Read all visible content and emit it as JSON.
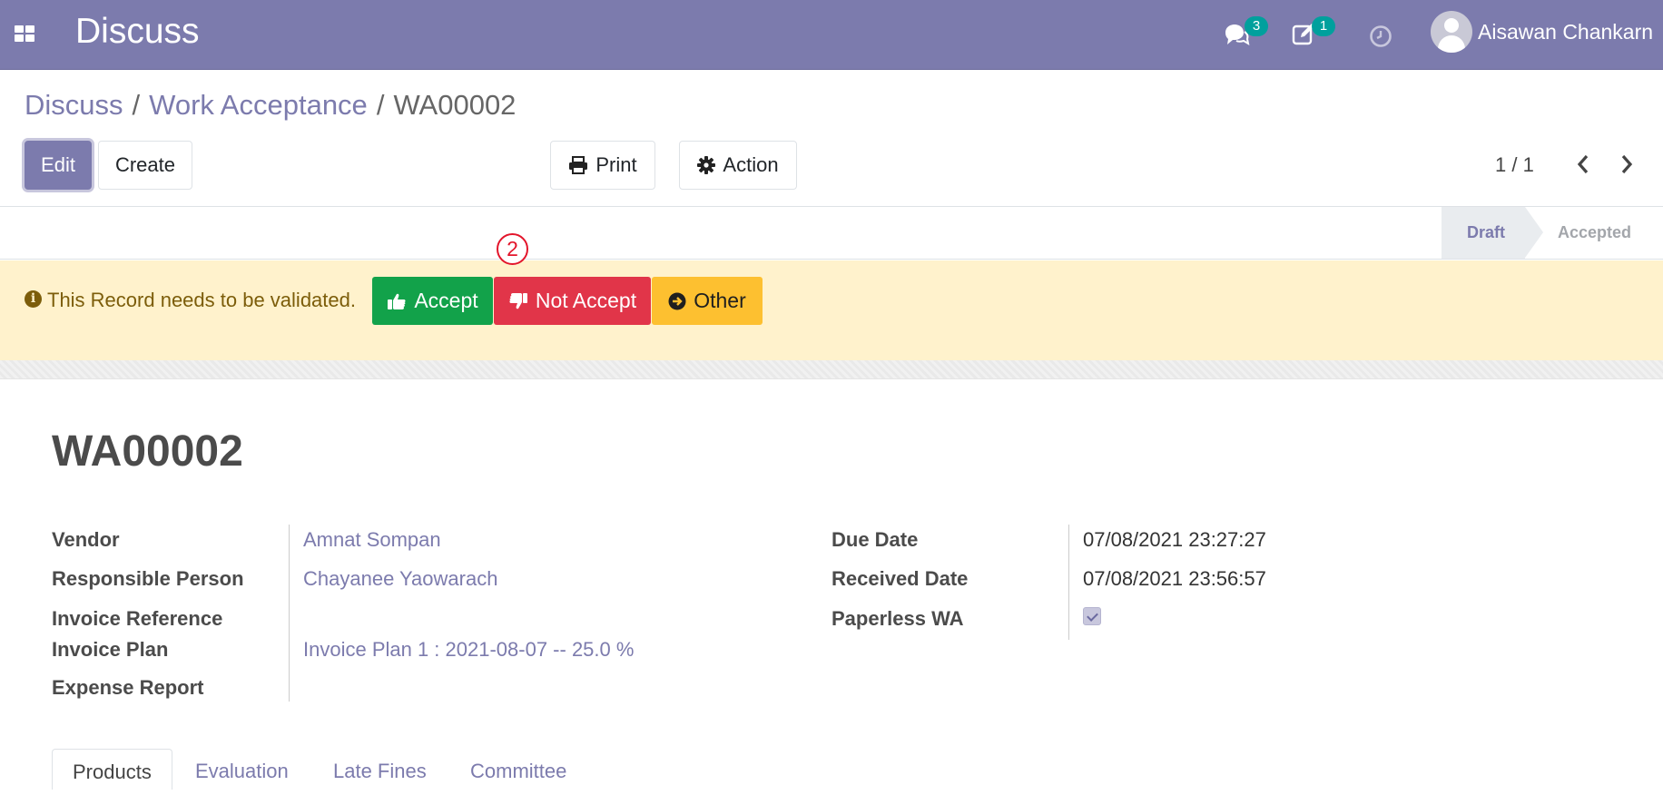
{
  "navbar": {
    "app_title": "Discuss",
    "messages_badge": "3",
    "activities_badge": "1",
    "user_name": "Aisawan Chankarn",
    "background": "#7c7bad"
  },
  "breadcrumb": {
    "items": [
      "Discuss",
      "Work Acceptance",
      "WA00002"
    ],
    "separator": "/"
  },
  "toolbar": {
    "edit_label": "Edit",
    "create_label": "Create",
    "print_label": "Print",
    "action_label": "Action",
    "pager": "1 / 1"
  },
  "statusbar": {
    "stages": [
      "Draft",
      "Accepted"
    ],
    "current": "Draft"
  },
  "alert": {
    "message": "This Record needs to be validated.",
    "accept_label": "Accept",
    "not_accept_label": "Not Accept",
    "other_label": "Other",
    "annotation_number": "2",
    "colors": {
      "accept": "#12a24a",
      "not_accept": "#e13549",
      "other": "#fdc030",
      "background": "#fff2cc"
    }
  },
  "record": {
    "title": "WA00002",
    "left_fields": [
      {
        "label": "Vendor",
        "value": "Amnat Sompan"
      },
      {
        "label": "Responsible Person",
        "value": "Chayanee Yaowarach"
      },
      {
        "label": "Invoice Reference",
        "value": ""
      },
      {
        "label": "Invoice Plan",
        "value": "Invoice Plan 1 : 2021-08-07 -- 25.0 %"
      },
      {
        "label": "Expense Report",
        "value": ""
      }
    ],
    "right_fields": [
      {
        "label": "Due Date",
        "value": "07/08/2021 23:27:27"
      },
      {
        "label": "Received Date",
        "value": "07/08/2021 23:56:57"
      },
      {
        "label": "Paperless WA",
        "value": "checked"
      }
    ]
  },
  "tabs": [
    "Products",
    "Evaluation",
    "Late Fines",
    "Committee"
  ],
  "icons": {
    "apps": "apps-grid-icon",
    "messages": "chat-bubbles-icon",
    "activities": "edit-square-icon",
    "clock": "clock-icon",
    "print": "printer-icon",
    "action": "gear-icon",
    "info": "info-circle-icon",
    "accept": "thumbs-up-icon",
    "not_accept": "thumbs-down-icon",
    "other": "arrow-circle-right-icon"
  }
}
